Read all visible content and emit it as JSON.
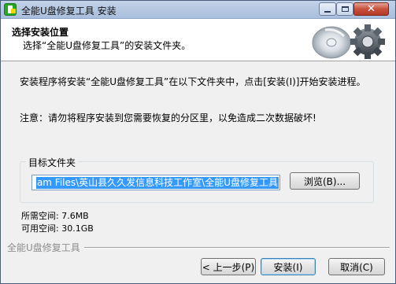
{
  "window": {
    "title": "全能U盘修复工具 安装",
    "controls": {
      "minimize": "minimize",
      "maximize": "maximize",
      "close": "✕"
    }
  },
  "header": {
    "title": "选择安装位置",
    "subtitle": "选择“全能U盘修复工具”的安装文件夹。"
  },
  "body": {
    "instruction": "安装程序将安装“全能U盘修复工具”在以下文件夹中，点击[安装(I)]开始安装进程。",
    "notice": "注意：请勿将程序安装到您需要恢复的分区里，以免造成二次数据破坏!"
  },
  "destination": {
    "group_label": "目标文件夹",
    "path_value": "am Files\\英山县久久发信息科技工作室\\全能U盘修复工具",
    "browse_label": "浏览(B)..."
  },
  "space": {
    "required": "所需空间: 7.6MB",
    "available": "可用空间: 30.1GB"
  },
  "footer": {
    "brand": "全能U盘修复工具",
    "back_label": "< 上一步(P)",
    "install_label": "安装(I)",
    "cancel_label": "取消(C)"
  },
  "icons": {
    "app": "usb-drive-icon",
    "header": "disc-gear-icon"
  },
  "colors": {
    "titlebar": "#b5c8e2",
    "selection": "#3399ff",
    "close": "#c7503c"
  }
}
